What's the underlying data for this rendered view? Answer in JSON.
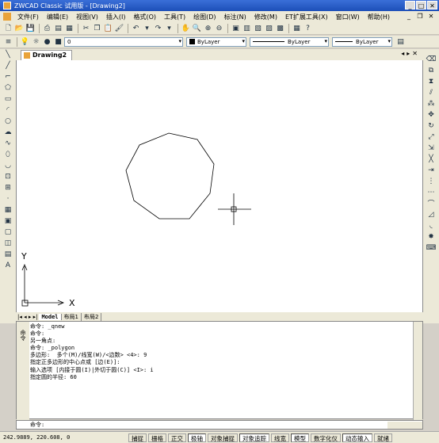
{
  "window": {
    "title": "ZWCAD Classic 试用版 - [Drawing2]"
  },
  "menu": [
    "文件(F)",
    "编辑(E)",
    "视图(V)",
    "插入(I)",
    "格式(O)",
    "工具(T)",
    "绘图(D)",
    "标注(N)",
    "修改(M)",
    "ET扩展工具(X)",
    "窗口(W)",
    "帮助(H)"
  ],
  "layers": {
    "current": "0",
    "color": "ByLayer",
    "linetype": "ByLayer",
    "lineweight": "ByLayer"
  },
  "document": {
    "tab": "Drawing2"
  },
  "layout_tabs": [
    "Model",
    "布局1",
    "布局2"
  ],
  "ucs": {
    "x_label": "X",
    "y_label": "Y"
  },
  "command_history": [
    "命令: _qnew",
    "命令:",
    "另一角点:",
    "命令: _polygon",
    "多边形:  多个(M)/线宽(W)/<边数> <4>: 9",
    "指定正多边形的中心点或 [边(E)]:",
    "输入选项 [内接于圆(I)|外切于圆(C)] <I>: i",
    "指定圆的半径: 60"
  ],
  "command_side_label": "命令",
  "command_prompt": "命令:",
  "status": {
    "coords": "242.9889, 220.608, 0",
    "buttons": [
      {
        "label": "捕捉",
        "on": false
      },
      {
        "label": "栅格",
        "on": false
      },
      {
        "label": "正交",
        "on": false
      },
      {
        "label": "极轴",
        "on": true
      },
      {
        "label": "对象捕捉",
        "on": false
      },
      {
        "label": "对象追踪",
        "on": true
      },
      {
        "label": "线宽",
        "on": false
      },
      {
        "label": "模型",
        "on": true
      },
      {
        "label": "数字化仪",
        "on": false
      },
      {
        "label": "动态输入",
        "on": true
      },
      {
        "label": "就绪",
        "on": false
      }
    ]
  },
  "colors": {
    "title_bar": "#1d4fb8",
    "canvas": "#ffffff",
    "chrome": "#ece9d8"
  }
}
